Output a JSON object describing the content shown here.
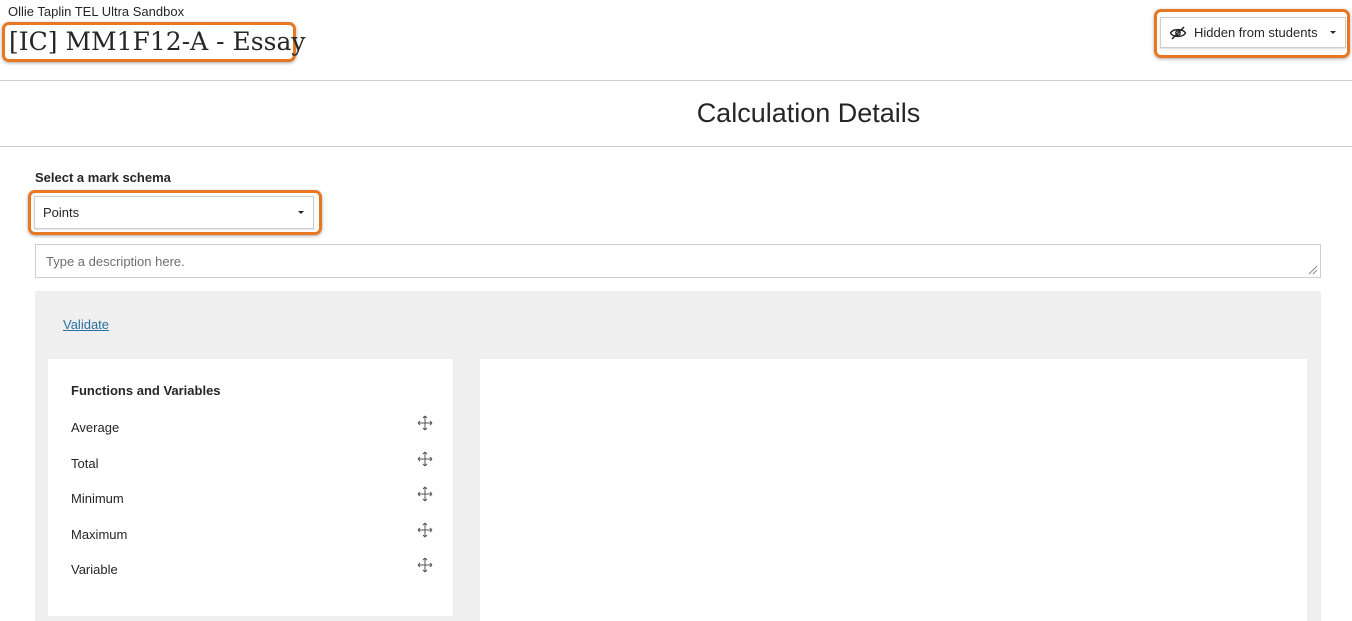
{
  "header": {
    "course_name": "Ollie Taplin TEL Ultra Sandbox",
    "page_title": "[IC] MM1F12-A - Essay",
    "visibility_label": "Hidden from students",
    "visibility_icon": "eye-slash-icon"
  },
  "main": {
    "section_title": "Calculation Details",
    "schema_label": "Select a mark schema",
    "schema_selected": "Points",
    "description_placeholder": "Type a description here.",
    "validate_label": "Validate",
    "functions_panel": {
      "title": "Functions and Variables",
      "items": [
        "Average",
        "Total",
        "Minimum",
        "Maximum",
        "Variable"
      ],
      "item_icon": "move-icon"
    }
  },
  "colors": {
    "highlight": "#e87722",
    "link": "#2b6f9e",
    "workspace_bg": "#efefef"
  }
}
